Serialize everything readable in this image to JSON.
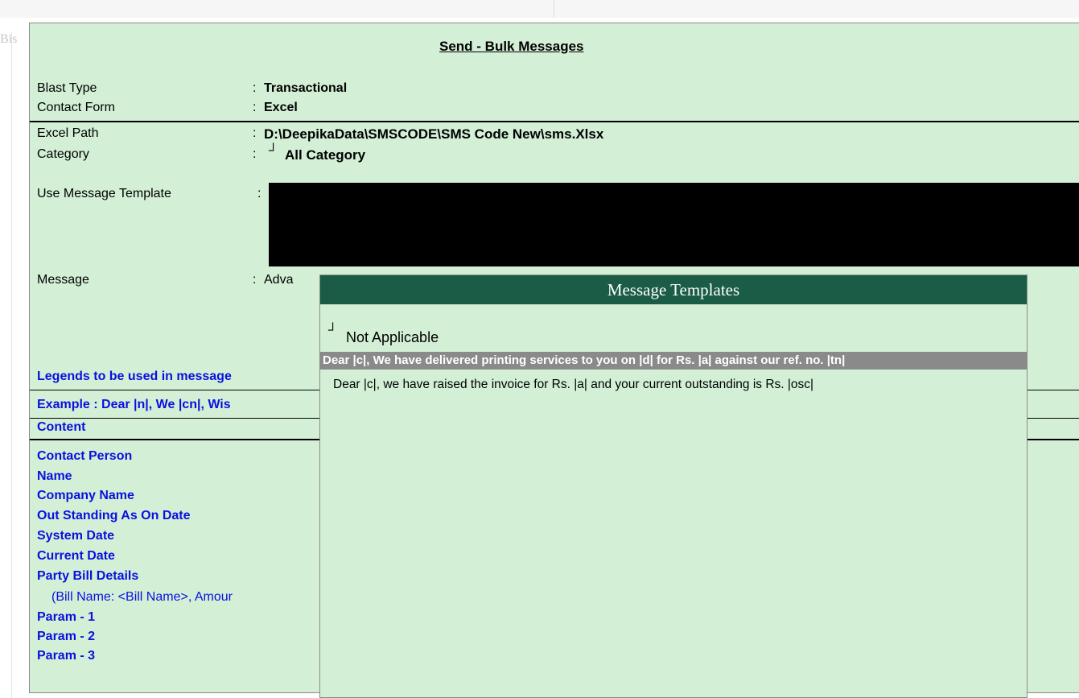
{
  "background": {
    "faded_text": "Bis"
  },
  "form": {
    "title": "Send - Bulk Messages",
    "separator": ":",
    "fields": {
      "blast_type": {
        "label": "Blast Type",
        "value": "Transactional"
      },
      "contact_form": {
        "label": "Contact Form",
        "value": "Excel"
      },
      "excel_path": {
        "label": "Excel Path",
        "value": "D:\\DeepikaData\\SMSCODE\\SMS Code New\\sms.Xlsx"
      },
      "category": {
        "label": "Category",
        "marker": "┘",
        "value": "All Category"
      },
      "use_message_template": {
        "label": "Use Message Template",
        "value": ""
      },
      "message": {
        "label": "Message",
        "value": "Adva"
      }
    },
    "legends_heading": "Legends to be used in message",
    "example": "Example : Dear |n|, We |cn|, Wis",
    "content_heading": "Content",
    "content_items": [
      "Contact Person",
      "Name",
      "Company Name",
      "Out Standing As On Date",
      "System Date",
      "Current Date",
      "Party Bill Details"
    ],
    "bill_details_note": "(Bill Name: <Bill Name>, Amour",
    "params": [
      "Param - 1",
      "Param - 2",
      "Param - 3"
    ]
  },
  "popup": {
    "title": "Message Templates",
    "not_applicable_marker": "┘",
    "not_applicable": "Not Applicable",
    "options": [
      "Dear |c|, We have delivered printing services to you on |d| for Rs. |a| against our ref. no. |tn|",
      "Dear |c|, we have raised the invoice for Rs. |a| and your current outstanding is Rs. |osc|"
    ],
    "selected_index": 0
  },
  "colors": {
    "panel_bg": "#d3f0d6",
    "popup_header": "#1a5c46",
    "selection": "#8a8a8a",
    "legend_blue": "#0a10e0"
  }
}
